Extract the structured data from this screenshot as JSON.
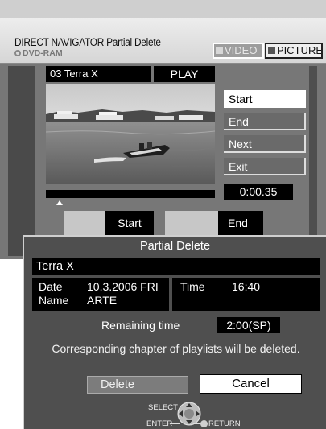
{
  "header": {
    "title": "DIRECT NAVIGATOR  Partial Delete",
    "subtitle": "DVD-RAM",
    "tabs": [
      {
        "label": "VIDEO",
        "active": false
      },
      {
        "label": "PICTURE",
        "active": true
      }
    ]
  },
  "program": {
    "name": "03 Terra X",
    "status": "PLAY"
  },
  "menu": {
    "items": [
      "Start",
      "End",
      "Next",
      "Exit"
    ],
    "selected_index": 0
  },
  "counter": "0:00.35",
  "markers": {
    "start_label": "Start",
    "end_label": "End"
  },
  "dialog": {
    "title": "Partial Delete",
    "program_name": "Terra X",
    "date_label": "Date",
    "date_value": "10.3.2006 FRI",
    "name_label": "Name",
    "name_value": "ARTE",
    "time_label": "Time",
    "time_value": "16:40",
    "remaining_label": "Remaining time",
    "remaining_value": "2:00(SP)",
    "warning": "Corresponding chapter of playlists will be deleted.",
    "delete_label": "Delete",
    "cancel_label": "Cancel"
  },
  "remote_hints": {
    "select": "SELECT",
    "enter": "ENTER",
    "return": "RETURN"
  },
  "colors": {
    "screen_background": "#777777",
    "dialog_background": "#4f4f4f",
    "highlight": "#ffffff",
    "panel": "#000000"
  },
  "icons": [
    "disc-icon",
    "dpad-icon",
    "return-icon",
    "timeline-marker-icon"
  ]
}
